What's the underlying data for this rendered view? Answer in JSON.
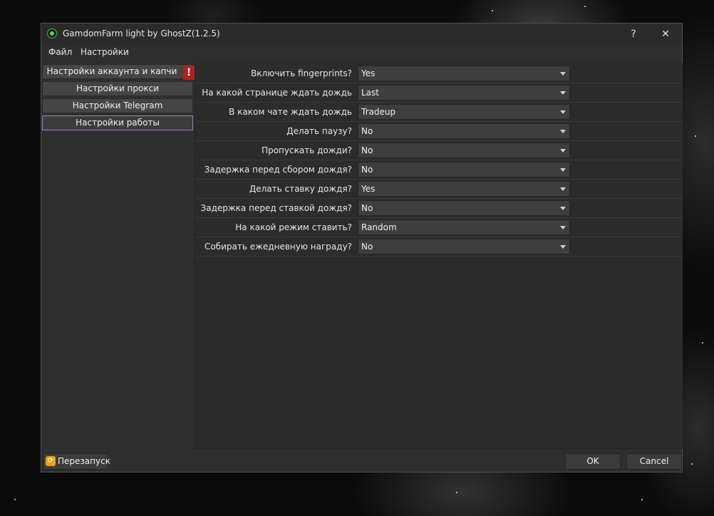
{
  "window": {
    "title": "GamdomFarm light by GhostZ(1.2.5)",
    "help_label": "?",
    "close_label": "✕"
  },
  "menu": {
    "items": [
      {
        "label": "Файл"
      },
      {
        "label": "Настройки"
      }
    ]
  },
  "sidebar": {
    "items": [
      {
        "label": "Настройки аккаунта и капчи",
        "alert": "!"
      },
      {
        "label": "Настройки прокси"
      },
      {
        "label": "Настройки Telegram"
      },
      {
        "label": "Настройки работы",
        "active": true
      }
    ]
  },
  "settings": {
    "rows": [
      {
        "label": "Включить fingerprints?",
        "value": "Yes"
      },
      {
        "label": "На какой странице ждать дождь",
        "value": "Last"
      },
      {
        "label": "В каком чате ждать дождь",
        "value": "Tradeup"
      },
      {
        "label": "Делать паузу?",
        "value": "No"
      },
      {
        "label": "Пропускать дожди?",
        "value": "No"
      },
      {
        "label": "Задержка перед сбором дождя?",
        "value": "No"
      },
      {
        "label": "Делать ставку дождя?",
        "value": "Yes"
      },
      {
        "label": "Задержка перед ставкой дождя?",
        "value": "No"
      },
      {
        "label": "На какой режим ставить?",
        "value": "Random"
      },
      {
        "label": "Собирать ежедневную награду?",
        "value": "No"
      }
    ]
  },
  "footer": {
    "restart_label": "Перезапуск",
    "ok_label": "OK",
    "cancel_label": "Cancel"
  },
  "colors": {
    "accent_border": "#a37ac6",
    "alert": "#b32020",
    "restart_icon": "#e7a31a"
  }
}
